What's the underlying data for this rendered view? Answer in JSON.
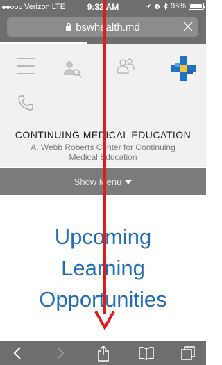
{
  "status_bar": {
    "carrier": "Verizon",
    "network": "LTE",
    "time": "9:32 AM",
    "battery": "95%",
    "signal_dots_filled": 2,
    "signal_dots_total": 5,
    "battery_level": 0.95
  },
  "browser": {
    "url": "bswhealth.md",
    "load_progress": 0.42
  },
  "header": {
    "icons": [
      "menu-icon",
      "find-doctor-icon",
      "find-location-icon",
      "bsw-logo",
      "phone-icon"
    ]
  },
  "title": {
    "main": "CONTINUING MEDICAL EDUCATION",
    "line1": "A. Webb Roberts Center for Continuing",
    "line2": "Medical Education"
  },
  "menu": {
    "label": "Show Menu"
  },
  "content": {
    "heading_line1": "Upcoming",
    "heading_line2": "Learning",
    "heading_line3": "Opportunities"
  },
  "colors": {
    "chrome": "#6e6e6e",
    "heading_blue": "#1f6db5",
    "annotation_red": "#e11a1a",
    "logo_blue": "#1d74c4",
    "logo_yellow": "#f4c33b"
  }
}
